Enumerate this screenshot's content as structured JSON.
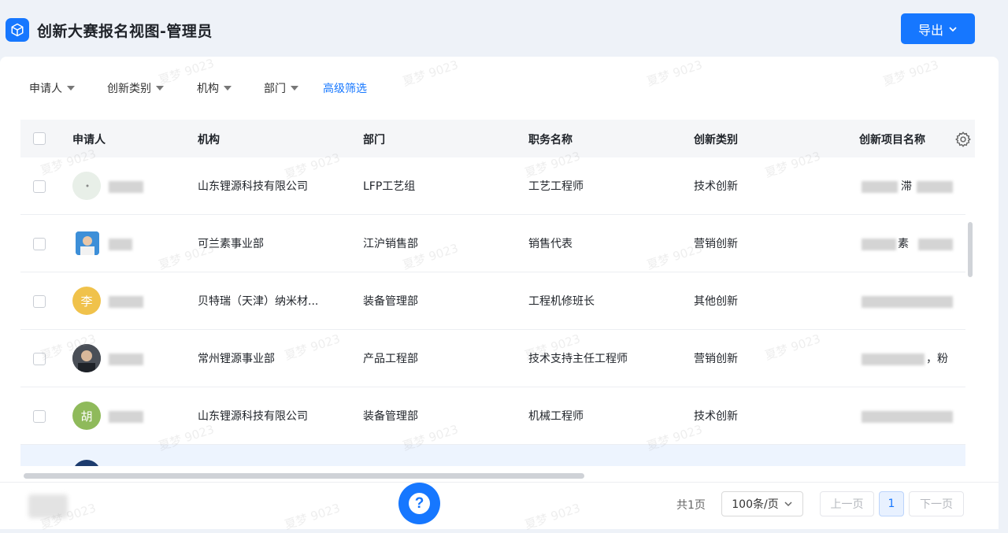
{
  "app": {
    "title": "创新大赛报名视图-管理员",
    "export_label": "导出",
    "brand_color": "#1677ff"
  },
  "filters": [
    {
      "label": "申请人"
    },
    {
      "label": "创新类别"
    },
    {
      "label": "机构"
    },
    {
      "label": "部门"
    }
  ],
  "advanced_filter_label": "高级筛选",
  "table": {
    "headers": [
      "申请人",
      "机构",
      "部门",
      "职务名称",
      "创新类别",
      "创新项目名称"
    ],
    "rows": [
      {
        "avatar": "photo-green",
        "org": "山东锂源科技有限公司",
        "dept": "LFP工艺组",
        "title": "工艺工程师",
        "category": "技术创新",
        "project_fragment": "滞"
      },
      {
        "avatar": "photo-blue",
        "org": "可兰素事业部",
        "dept": "江沪销售部",
        "title": "销售代表",
        "category": "营销创新",
        "project_fragment": "素"
      },
      {
        "avatar_text": "李",
        "avatar_color": "#f0c24b",
        "org": "贝特瑞（天津）纳米材...",
        "dept": "装备管理部",
        "title": "工程机修班长",
        "category": "其他创新",
        "project_fragment": ""
      },
      {
        "avatar": "photo-dark",
        "org": "常州锂源事业部",
        "dept": "产品工程部",
        "title": "技术支持主任工程师",
        "category": "营销创新",
        "project_fragment": "，粉"
      },
      {
        "avatar_text": "胡",
        "avatar_color": "#8fba5b",
        "org": "山东锂源科技有限公司",
        "dept": "装备管理部",
        "title": "机械工程师",
        "category": "技术创新",
        "project_fragment": ""
      }
    ]
  },
  "pagination": {
    "total_label": "共1页",
    "page_size_label": "100条/页",
    "prev_label": "上一页",
    "next_label": "下一页",
    "current_page": "1"
  },
  "watermark": "夏梦 9023"
}
